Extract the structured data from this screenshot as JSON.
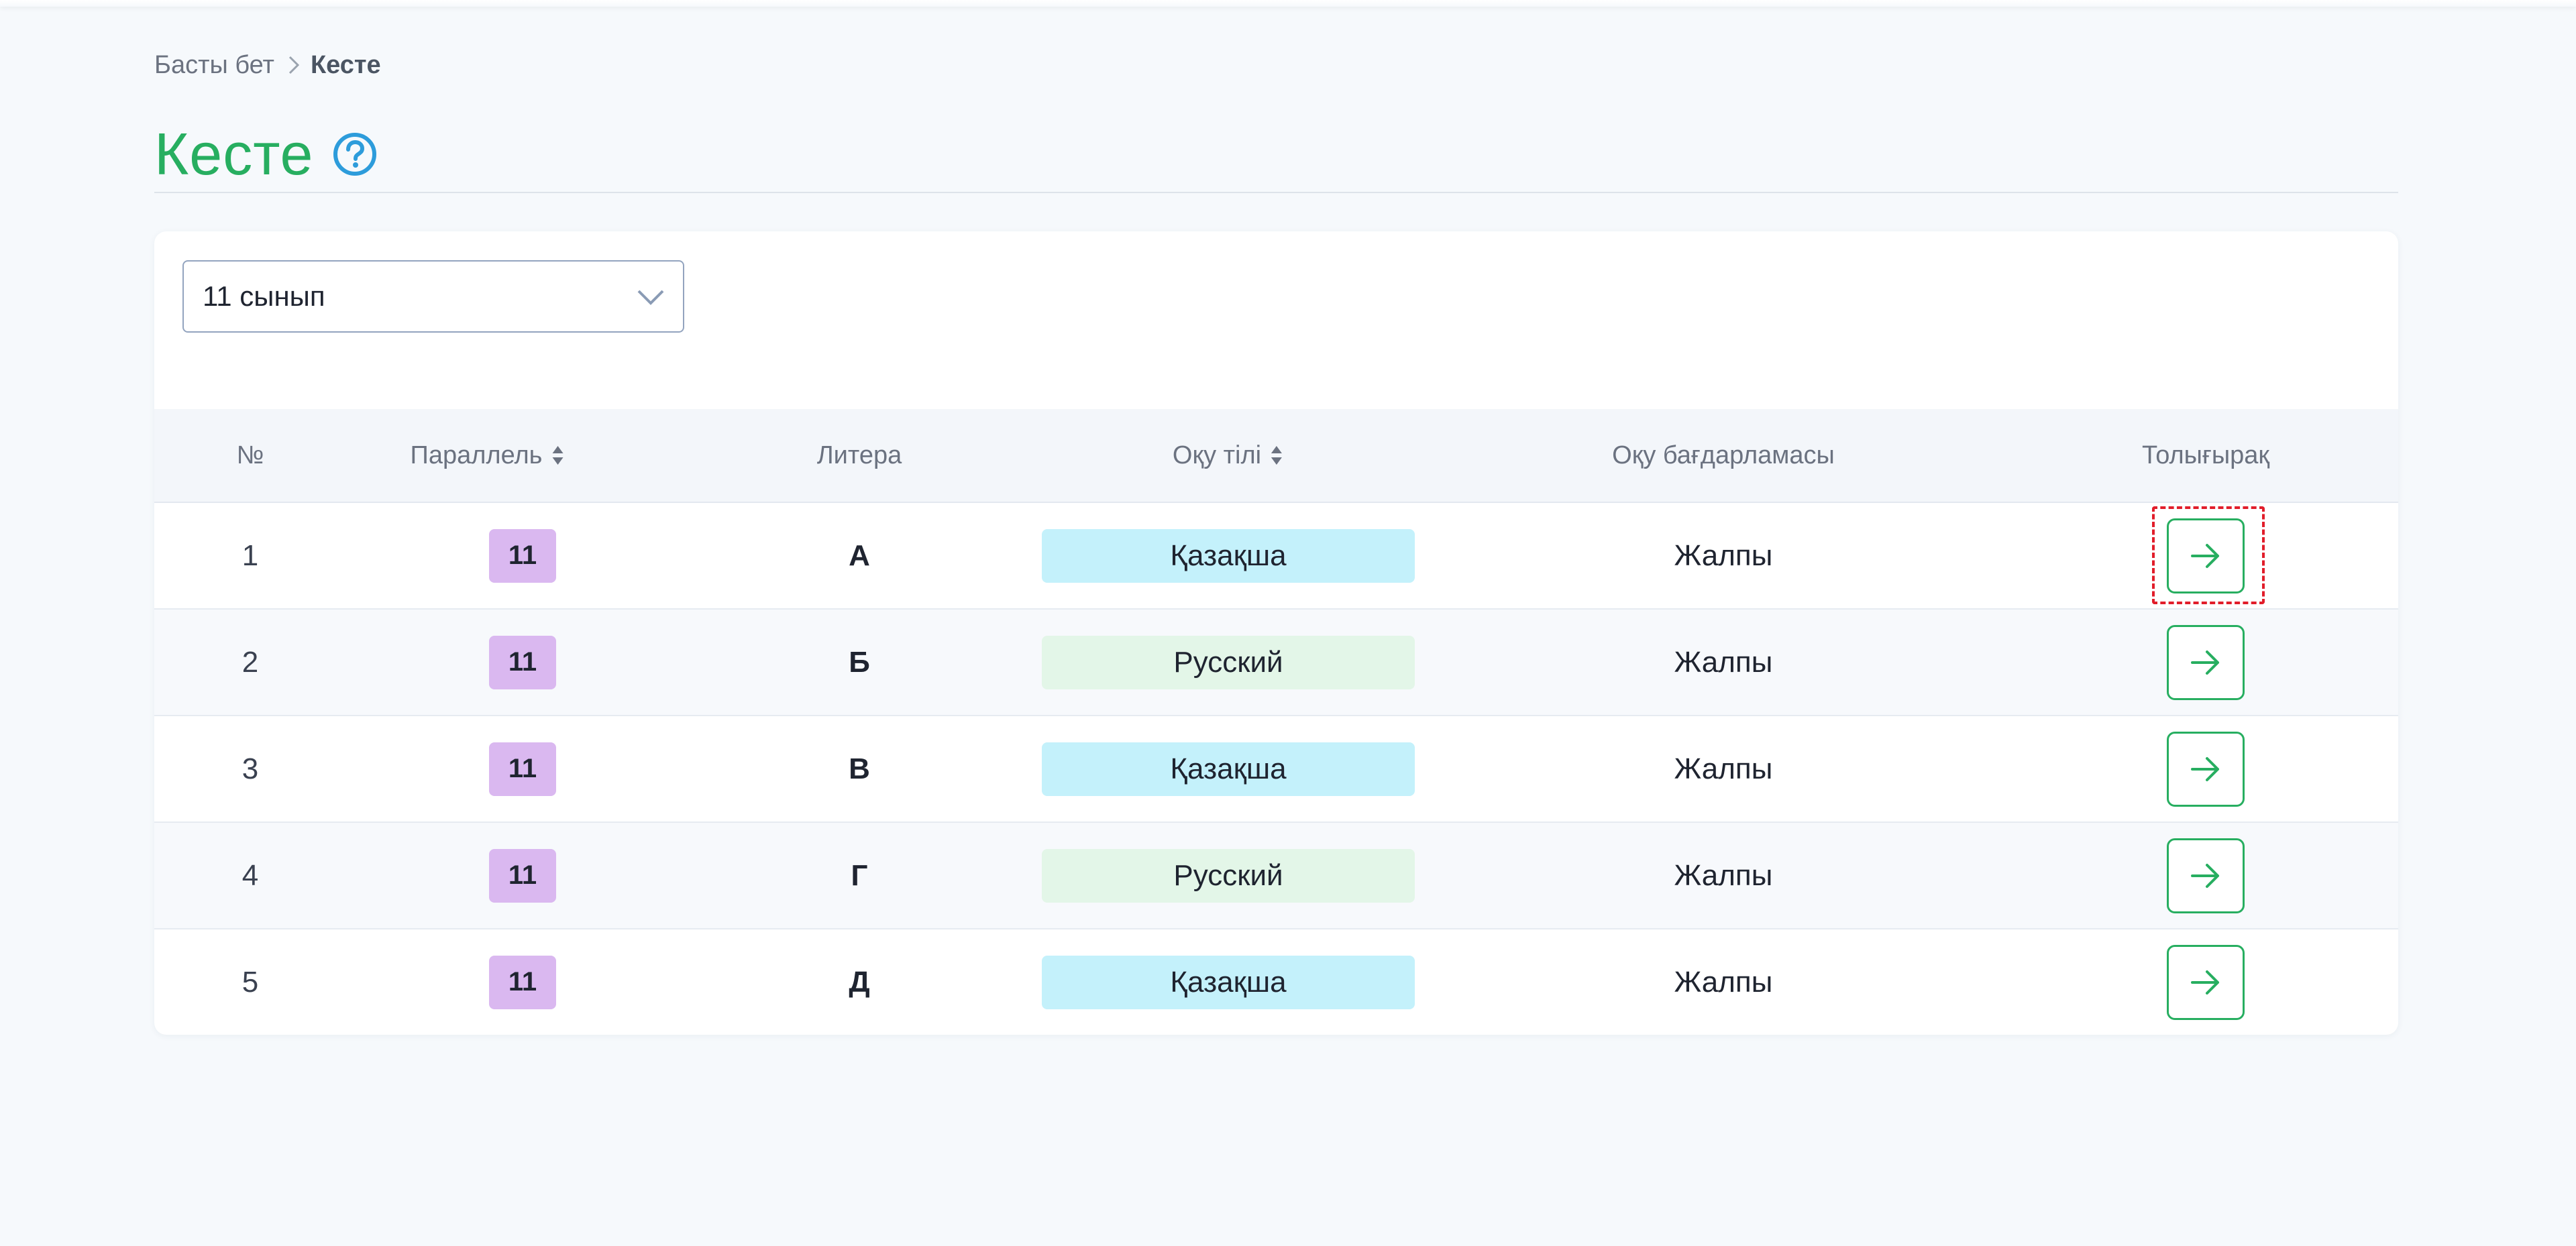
{
  "breadcrumb": {
    "home": "Басты бет",
    "current": "Кесте"
  },
  "page": {
    "title": "Кесте",
    "help_icon": "question-circle-icon"
  },
  "filter": {
    "class_select_value": "11 сынып"
  },
  "table": {
    "headers": {
      "number": "№",
      "parallel": "Параллель",
      "litera": "Литера",
      "language": "Оқу тілі",
      "program": "Оқу бағдарламасы",
      "more": "Толығырақ"
    },
    "rows": [
      {
        "number": "1",
        "parallel": "11",
        "litera": "А",
        "language": "Қазақша",
        "program": "Жалпы"
      },
      {
        "number": "2",
        "parallel": "11",
        "litera": "Б",
        "language": "Русский",
        "program": "Жалпы"
      },
      {
        "number": "3",
        "parallel": "11",
        "litera": "В",
        "language": "Қазақша",
        "program": "Жалпы"
      },
      {
        "number": "4",
        "parallel": "11",
        "litera": "Г",
        "language": "Русский",
        "program": "Жалпы"
      },
      {
        "number": "5",
        "parallel": "11",
        "litera": "Д",
        "language": "Қазақша",
        "program": "Жалпы"
      }
    ]
  },
  "colors": {
    "accent_green": "#27ae60",
    "help_blue": "#2d9cdb",
    "grade_badge": "#dab8f0",
    "lang_kazakh": "#c4f1fb",
    "lang_russian": "#e3f6e8",
    "focus_highlight": "#e11d2a"
  }
}
